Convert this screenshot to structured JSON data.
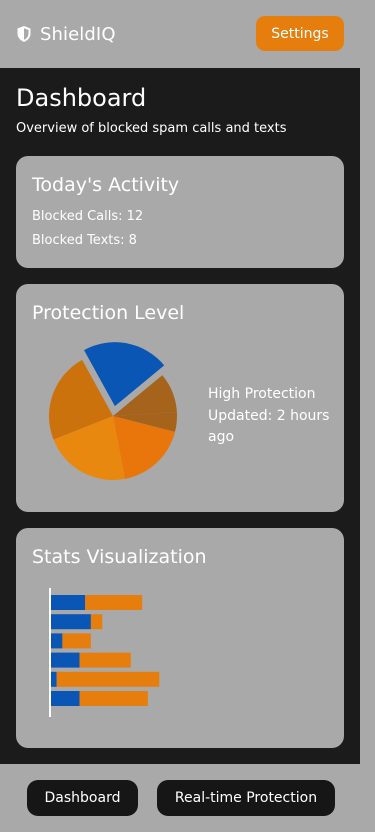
{
  "colors": {
    "accent": "#e67e0e",
    "card": "#a9a9a9",
    "background": "#1b1b1b",
    "blue": "#0a56b4"
  },
  "header": {
    "brand_icon": "shield-icon",
    "app_name": "ShieldIQ",
    "settings_label": "Settings"
  },
  "page": {
    "title": "Dashboard",
    "subtitle": "Overview of blocked spam calls and texts"
  },
  "activity": {
    "title": "Today's Activity",
    "blocked_calls": "Blocked Calls: 12",
    "blocked_texts": "Blocked Texts: 8"
  },
  "protection": {
    "title": "Protection Level",
    "level": "High Protection",
    "updated": "Updated: 2 hours ago"
  },
  "stats": {
    "title": "Stats Visualization"
  },
  "chart_data": [
    {
      "type": "pie",
      "title": "",
      "slices": [
        {
          "value": 22,
          "color": "#0a56b4",
          "exploded": true
        },
        {
          "value": 10,
          "color": "#a5631c"
        },
        {
          "value": 5,
          "color": "#a5631c"
        },
        {
          "value": 18,
          "color": "#e8760a"
        },
        {
          "value": 22,
          "color": "#e8880f"
        },
        {
          "value": 23,
          "color": "#cc720d"
        }
      ]
    },
    {
      "type": "bar",
      "orientation": "horizontal",
      "stacked": true,
      "title": "",
      "series": [
        {
          "values": [
            6,
            7,
            2,
            5,
            1,
            5
          ],
          "color": "#0a56b4"
        },
        {
          "values": [
            10,
            2,
            5,
            9,
            18,
            12
          ],
          "color": "#e67e0e"
        }
      ]
    }
  ],
  "nav": {
    "dashboard": "Dashboard",
    "realtime": "Real-time Protection"
  }
}
